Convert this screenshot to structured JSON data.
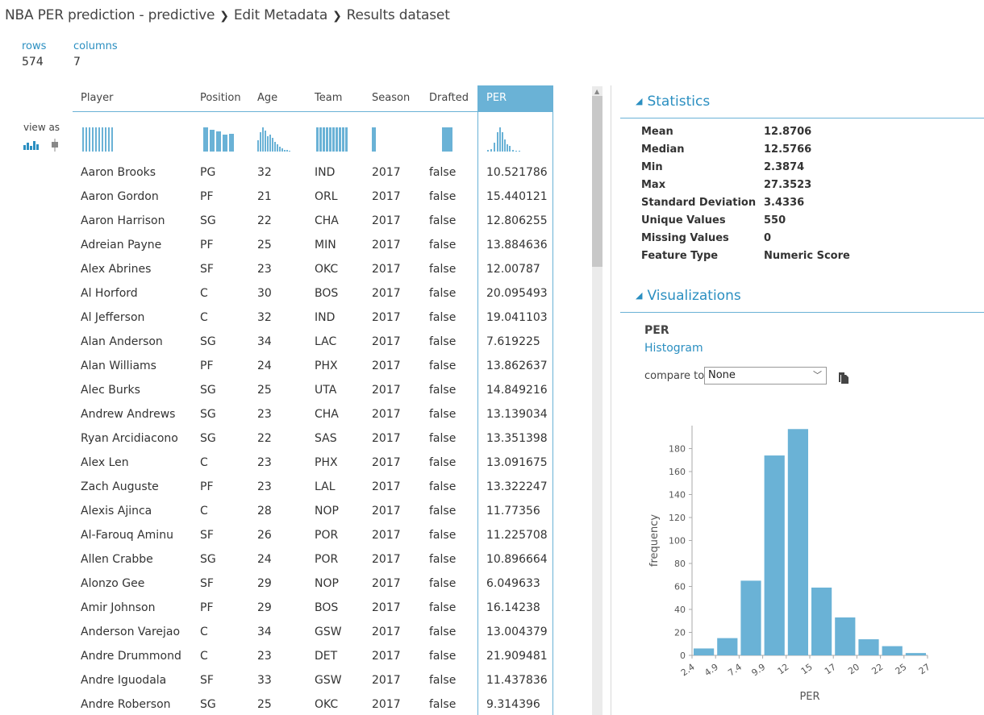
{
  "breadcrumb": {
    "items": [
      "NBA PER prediction - predictive",
      "Edit Metadata",
      "Results dataset"
    ],
    "separator": "›"
  },
  "summary": {
    "rows_label": "rows",
    "rows_value": "574",
    "columns_label": "columns",
    "columns_value": "7"
  },
  "view_as": "view as",
  "table": {
    "columns": [
      "Player",
      "Position",
      "Age",
      "Team",
      "Season",
      "Drafted",
      "PER"
    ],
    "selected_column": "PER",
    "rows": [
      [
        "Aaron Brooks",
        "PG",
        "32",
        "IND",
        "2017",
        "false",
        "10.521786"
      ],
      [
        "Aaron Gordon",
        "PF",
        "21",
        "ORL",
        "2017",
        "false",
        "15.440121"
      ],
      [
        "Aaron Harrison",
        "SG",
        "22",
        "CHA",
        "2017",
        "false",
        "12.806255"
      ],
      [
        "Adreian Payne",
        "PF",
        "25",
        "MIN",
        "2017",
        "false",
        "13.884636"
      ],
      [
        "Alex Abrines",
        "SF",
        "23",
        "OKC",
        "2017",
        "false",
        "12.00787"
      ],
      [
        "Al Horford",
        "C",
        "30",
        "BOS",
        "2017",
        "false",
        "20.095493"
      ],
      [
        "Al Jefferson",
        "C",
        "32",
        "IND",
        "2017",
        "false",
        "19.041103"
      ],
      [
        "Alan Anderson",
        "SG",
        "34",
        "LAC",
        "2017",
        "false",
        "7.619225"
      ],
      [
        "Alan Williams",
        "PF",
        "24",
        "PHX",
        "2017",
        "false",
        "13.862637"
      ],
      [
        "Alec Burks",
        "SG",
        "25",
        "UTA",
        "2017",
        "false",
        "14.849216"
      ],
      [
        "Andrew Andrews",
        "SG",
        "23",
        "CHA",
        "2017",
        "false",
        "13.139034"
      ],
      [
        "Ryan Arcidiacono",
        "SG",
        "22",
        "SAS",
        "2017",
        "false",
        "13.351398"
      ],
      [
        "Alex Len",
        "C",
        "23",
        "PHX",
        "2017",
        "false",
        "13.091675"
      ],
      [
        "Zach Auguste",
        "PF",
        "23",
        "LAL",
        "2017",
        "false",
        "13.322247"
      ],
      [
        "Alexis Ajinca",
        "C",
        "28",
        "NOP",
        "2017",
        "false",
        "11.77356"
      ],
      [
        "Al-Farouq Aminu",
        "SF",
        "26",
        "POR",
        "2017",
        "false",
        "11.225708"
      ],
      [
        "Allen Crabbe",
        "SG",
        "24",
        "POR",
        "2017",
        "false",
        "10.896664"
      ],
      [
        "Alonzo Gee",
        "SF",
        "29",
        "NOP",
        "2017",
        "false",
        "6.049633"
      ],
      [
        "Amir Johnson",
        "PF",
        "29",
        "BOS",
        "2017",
        "false",
        "16.14238"
      ],
      [
        "Anderson Varejao",
        "C",
        "34",
        "GSW",
        "2017",
        "false",
        "13.004379"
      ],
      [
        "Andre Drummond",
        "C",
        "23",
        "DET",
        "2017",
        "false",
        "21.909481"
      ],
      [
        "Andre Iguodala",
        "SF",
        "33",
        "GSW",
        "2017",
        "false",
        "11.437836"
      ],
      [
        "Andre Roberson",
        "SG",
        "25",
        "OKC",
        "2017",
        "false",
        "9.314396"
      ]
    ]
  },
  "statistics": {
    "title": "Statistics",
    "items": [
      {
        "key": "Mean",
        "value": "12.8706"
      },
      {
        "key": "Median",
        "value": "12.5766"
      },
      {
        "key": "Min",
        "value": "2.3874"
      },
      {
        "key": "Max",
        "value": "27.3523"
      },
      {
        "key": "Standard Deviation",
        "value": "3.4336"
      },
      {
        "key": "Unique Values",
        "value": "550"
      },
      {
        "key": "Missing Values",
        "value": "0"
      },
      {
        "key": "Feature Type",
        "value": "Numeric Score"
      }
    ]
  },
  "visualizations": {
    "title": "Visualizations",
    "column_name": "PER",
    "type_label": "Histogram",
    "compare_label": "compare to",
    "compare_value": "None"
  },
  "colors": {
    "accent": "#2b8fc1",
    "bar": "#6ab2d6",
    "header_selected": "#6ab2d6"
  },
  "chart_data": {
    "type": "bar",
    "categories": [
      "2.4",
      "4.9",
      "7.4",
      "9.9",
      "12",
      "15",
      "17",
      "20",
      "22",
      "25",
      "27"
    ],
    "values": [
      6,
      15,
      65,
      174,
      197,
      59,
      33,
      14,
      8,
      2
    ],
    "xlabel": "PER",
    "ylabel": "frequency",
    "ylim": [
      0,
      200
    ],
    "yticks": [
      0,
      20,
      40,
      60,
      80,
      100,
      120,
      140,
      160,
      180
    ],
    "grid": false
  }
}
